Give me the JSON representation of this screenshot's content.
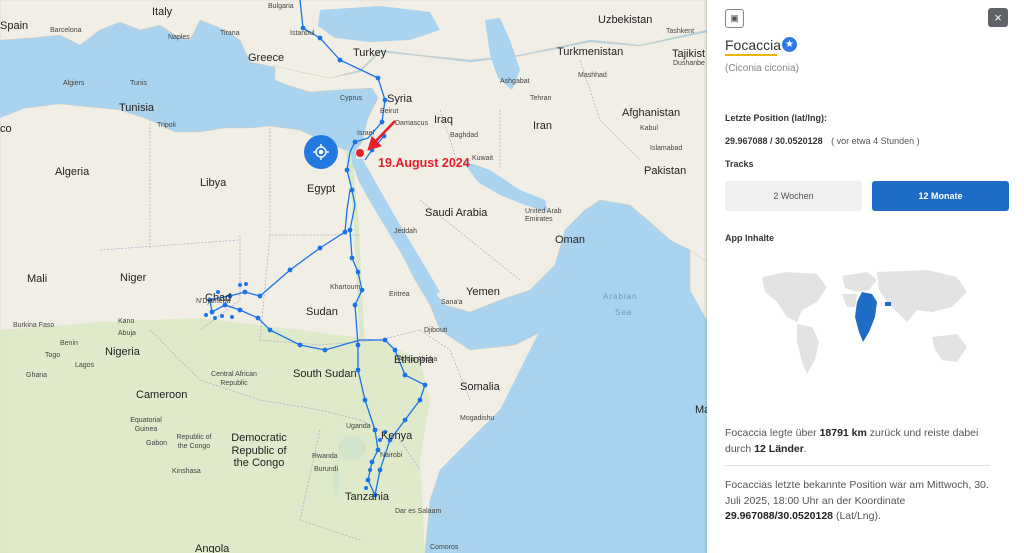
{
  "map": {
    "annotation": "19.August 2024",
    "countries": [
      "Italy",
      "Bulgaria",
      "Uzbekistan",
      "Spain",
      "Turkey",
      "Turkmenistan",
      "Greece",
      "Tajikist",
      "Tunisia",
      "Syria",
      "Afghanistan",
      "Iraq",
      "Iran",
      "Algeria",
      "Libya",
      "Egypt",
      "Pakistan",
      "Saudi Arabia",
      "Oman",
      "Mali",
      "Niger",
      "Chad",
      "Sudan",
      "Yemen",
      "Nigeria",
      "Ethiopia",
      "South Sudan",
      "Somalia",
      "Cameroon",
      "Kenya",
      "Democratic Republic of the Congo",
      "Tanzania",
      "Angola",
      "co",
      "Ma"
    ],
    "cities": [
      "Barcelona",
      "Naples",
      "Tirana",
      "Istanbul",
      "Ashgabat",
      "Mashhad",
      "Tashkent",
      "Dushanbe",
      "Algiers",
      "Tunis",
      "Tripoli",
      "Cyprus",
      "Beirut",
      "Damascus",
      "Baghdad",
      "Kuwait",
      "Tehran",
      "Kabul",
      "Islamabad",
      "Israel",
      "United Arab Emirates",
      "Jeddah",
      "Khartoum",
      "Eritrea",
      "Sana'a",
      "Djibouti",
      "Addis Ababa",
      "Mogadishu",
      "N'Djamena",
      "Kano",
      "Abuja",
      "Lagos",
      "Ghana",
      "Burkina Faso",
      "Benin",
      "Togo",
      "Central African Republic",
      "Equatorial Guinea",
      "Gabon",
      "Republic of the Congo",
      "Kinshasa",
      "Rwanda",
      "Burundi",
      "Uganda",
      "Nairobi",
      "Comoros",
      "Dar es Salaam"
    ],
    "seas": [
      "Arabian",
      "Sea"
    ]
  },
  "panel": {
    "expand_icon": "expand-icon",
    "close_icon": "×",
    "bird_name": "Focaccia",
    "scientific_name": "(Ciconia ciconia)",
    "last_position_label": "Letzte Position (lat/lng):",
    "coords": "29.967088 / 30.0520128",
    "time_ago": "( vor etwa 4 Stunden )",
    "tracks_label": "Tracks",
    "btn_2w": "2 Wochen",
    "btn_12m": "12 Monate",
    "app_content_label": "App Inhalte",
    "distance_text": {
      "pre": "Focaccia legte über ",
      "km": "18791 km",
      "mid": " zurück und reiste dabei durch ",
      "countries": "12 Länder",
      "post": "."
    },
    "last_known_text": {
      "pre": "Focaccias letzte bekannte Position war am Mittwoch, 30. Juli 2025, 18:00 Uhr an der Koordinate ",
      "coord": "29.967088/30.0520128",
      "post": " (Lat/Lng)."
    },
    "colors": {
      "accent": "#1f6cc6",
      "track": "#1a73e8",
      "highlight": "#e5202a",
      "underline": "#f0b400"
    }
  }
}
